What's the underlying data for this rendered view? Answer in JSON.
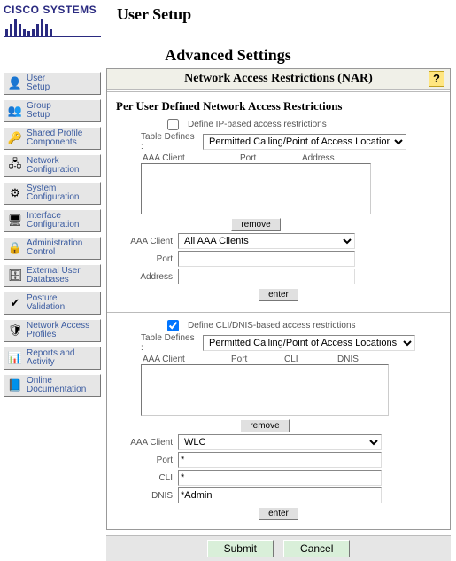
{
  "brand": "CISCO SYSTEMS",
  "page_title": "User Setup",
  "subtitle": "Advanced Settings",
  "sidebar": {
    "items": [
      {
        "label": "User\nSetup",
        "icon": "👤"
      },
      {
        "label": "Group\nSetup",
        "icon": "👥"
      },
      {
        "label": "Shared Profile\nComponents",
        "icon": "🔑"
      },
      {
        "label": "Network\nConfiguration",
        "icon": "🖧"
      },
      {
        "label": "System\nConfiguration",
        "icon": "⚙"
      },
      {
        "label": "Interface\nConfiguration",
        "icon": "🖥"
      },
      {
        "label": "Administration\nControl",
        "icon": "🔒"
      },
      {
        "label": "External User\nDatabases",
        "icon": "🗄"
      },
      {
        "label": "Posture\nValidation",
        "icon": "✔"
      },
      {
        "label": "Network Access\nProfiles",
        "icon": "🛡"
      },
      {
        "label": "Reports and\nActivity",
        "icon": "📊"
      },
      {
        "label": "Online\nDocumentation",
        "icon": "📘"
      }
    ]
  },
  "panel": {
    "title": "Network Access Restrictions (NAR)"
  },
  "nar": {
    "heading": "Per User Defined Network Access Restrictions",
    "ip": {
      "enabled": false,
      "define_label": "Define IP-based access restrictions",
      "table_defines_label": "Table Defines :",
      "table_defines": "Permitted Calling/Point of Access Locations",
      "cols": {
        "c1": "AAA Client",
        "c2": "Port",
        "c3": "Address"
      },
      "remove_label": "remove",
      "aaa_client_label": "AAA Client",
      "aaa_client": "All AAA Clients",
      "port_label": "Port",
      "port": "",
      "address_label": "Address",
      "address": "",
      "enter_label": "enter"
    },
    "cli": {
      "enabled": true,
      "define_label": "Define CLI/DNIS-based access restrictions",
      "table_defines_label": "Table Defines :",
      "table_defines": "Permitted Calling/Point of Access Locations",
      "cols": {
        "c1": "AAA Client",
        "c2": "Port",
        "c3": "CLI",
        "c4": "DNIS"
      },
      "remove_label": "remove",
      "aaa_client_label": "AAA Client",
      "aaa_client": "WLC",
      "port_label": "Port",
      "port": "*",
      "cli_label": "CLI",
      "cli": "*",
      "dnis_label": "DNIS",
      "dnis": "*Admin",
      "enter_label": "enter"
    }
  },
  "footer": {
    "submit": "Submit",
    "cancel": "Cancel"
  }
}
